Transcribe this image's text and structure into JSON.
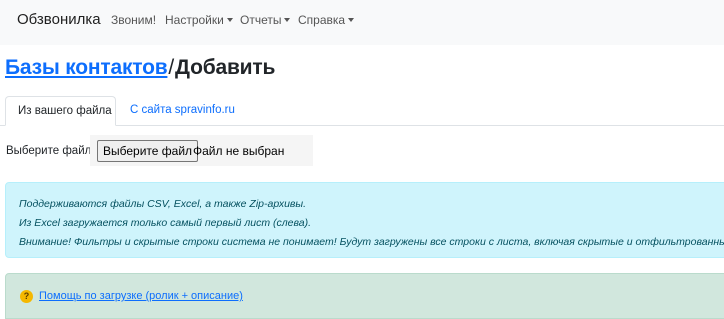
{
  "navbar": {
    "brand": "Обзвонилка",
    "items": [
      {
        "label": "Звоним!",
        "dropdown": false
      },
      {
        "label": "Настройки",
        "dropdown": true
      },
      {
        "label": "Отчеты",
        "dropdown": true
      },
      {
        "label": "Справка",
        "dropdown": true
      }
    ]
  },
  "header": {
    "breadcrumb_link": "Базы контактов",
    "separator": "/",
    "current": "Добавить"
  },
  "tabs": [
    {
      "label": "Из вашего файла",
      "active": true
    },
    {
      "label": "С сайта spravinfo.ru",
      "active": false
    }
  ],
  "upload": {
    "label": "Выберите файл",
    "button_label": "Выберите файл",
    "status": "Файл не выбран"
  },
  "info_alert": {
    "lines": [
      "Поддерживаются файлы CSV, Excel, а также Zip-архивы.",
      "Из Excel загружается только самый первый лист (слева).",
      "Внимание! Фильтры и скрытые строки система не понимает! Будут загружены все строки с листа, включая скрытые и отфильтрованные."
    ]
  },
  "help_alert": {
    "icon": "?",
    "link": "Помощь по загрузке (ролик + описание)"
  },
  "colors": {
    "link": "#0d6efd",
    "info_bg": "#cff4fc",
    "success_bg": "#d1e7dd",
    "navbar_bg": "#f8f9fa"
  }
}
